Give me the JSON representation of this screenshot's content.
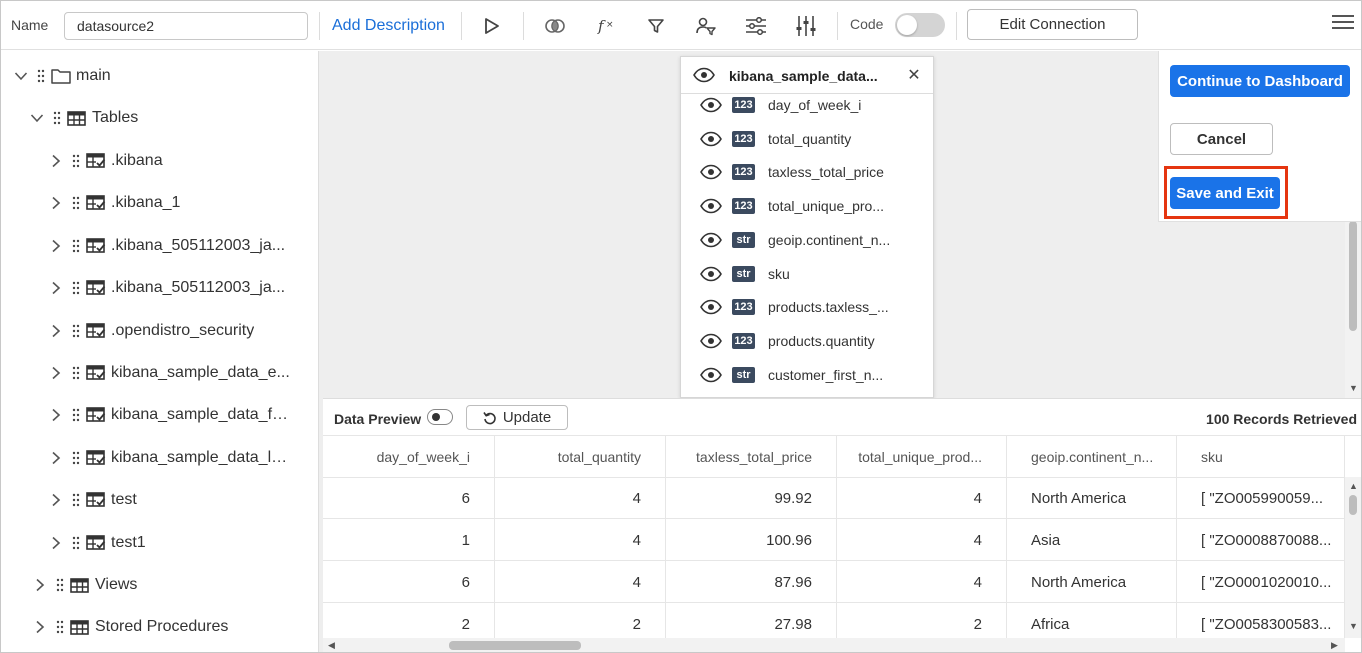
{
  "toolbar": {
    "name_label": "Name",
    "name_value": "datasource2",
    "add_description": "Add Description",
    "code_label": "Code",
    "edit_connection": "Edit Connection"
  },
  "tree": {
    "root": "main",
    "tables": "Tables",
    "items": [
      ".kibana",
      ".kibana_1",
      ".kibana_505112003_ja...",
      ".kibana_505112003_ja...",
      ".opendistro_security",
      "kibana_sample_data_e...",
      "kibana_sample_data_fli...",
      "kibana_sample_data_lo...",
      "test",
      "test1"
    ],
    "views": "Views",
    "stored_procedures": "Stored Procedures"
  },
  "table_card": {
    "title": "kibana_sample_data...",
    "columns": [
      {
        "type": "123",
        "name": "day_of_week_i"
      },
      {
        "type": "123",
        "name": "total_quantity"
      },
      {
        "type": "123",
        "name": "taxless_total_price"
      },
      {
        "type": "123",
        "name": "total_unique_pro..."
      },
      {
        "type": "str",
        "name": "geoip.continent_n..."
      },
      {
        "type": "str",
        "name": "sku"
      },
      {
        "type": "123",
        "name": "products.taxless_..."
      },
      {
        "type": "123",
        "name": "products.quantity"
      },
      {
        "type": "str",
        "name": "customer_first_n..."
      }
    ]
  },
  "actions": {
    "continue": "Continue to Dashboard",
    "cancel": "Cancel",
    "save_exit": "Save and Exit"
  },
  "preview": {
    "label": "Data Preview",
    "update": "Update",
    "records": "100 Records Retrieved"
  },
  "grid": {
    "headers": [
      "day_of_week_i",
      "total_quantity",
      "taxless_total_price",
      "total_unique_prod...",
      "geoip.continent_n...",
      "sku"
    ],
    "rows": [
      [
        "6",
        "4",
        "99.92",
        "4",
        "North America",
        "[ \"ZO005990059..."
      ],
      [
        "1",
        "4",
        "100.96",
        "4",
        "Asia",
        "[ \"ZO0008870088..."
      ],
      [
        "6",
        "4",
        "87.96",
        "4",
        "North America",
        "[ \"ZO0001020010..."
      ],
      [
        "2",
        "2",
        "27.98",
        "2",
        "Africa",
        "[ \"ZO0058300583..."
      ]
    ]
  },
  "colors": {
    "primary": "#1a73e8",
    "highlight": "#e53510",
    "badge": "#3b4a5f",
    "canvas": "#eeeeee"
  }
}
